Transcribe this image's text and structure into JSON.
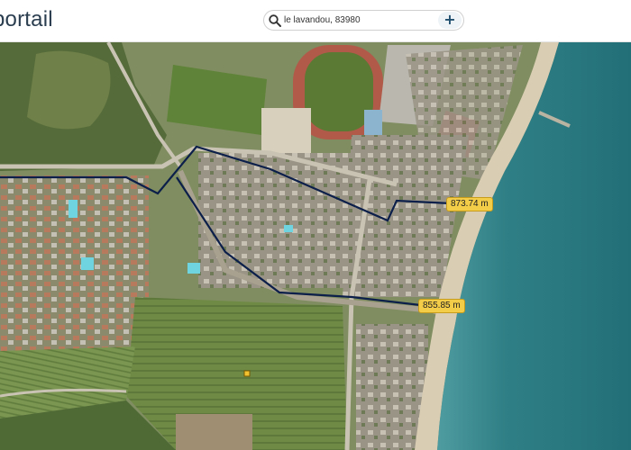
{
  "header": {
    "brand": "portail"
  },
  "search": {
    "value": "le lavandou, 83980",
    "add_symbol": "+",
    "icon": "search-icon"
  },
  "map": {
    "type": "aerial",
    "measurements": [
      {
        "label": "873.74 m"
      },
      {
        "label": "855.85 m"
      }
    ],
    "route_color": "#0c1f4a",
    "label_color": "#f3cc48"
  }
}
